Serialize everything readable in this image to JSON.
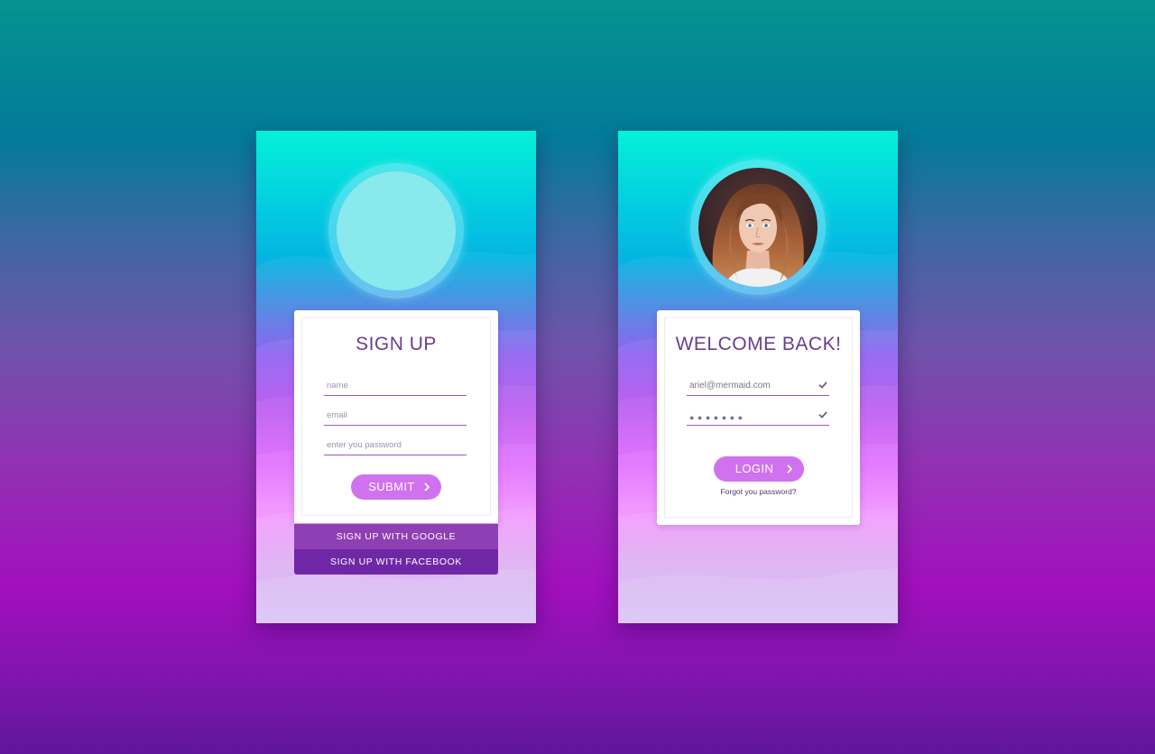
{
  "signup_card": {
    "title": "SIGN UP",
    "name_placeholder": "name",
    "email_placeholder": "email",
    "password_placeholder": "enter you password",
    "submit_label": "SUBMIT",
    "google_label": "SIGN UP WITH GOOGLE",
    "facebook_label": "SIGN UP WITH FACEBOOK"
  },
  "login_card": {
    "title": "WELCOME BACK!",
    "email_value": "ariel@mermaid.com",
    "password_value": "●●●●●●●",
    "login_label": "LOGIN",
    "forgot_label": "Forgot you password?"
  },
  "icons": {
    "chevron": "chevron-right-icon",
    "check": "check-icon"
  },
  "colors": {
    "accent_button": "#d071ef",
    "google_button": "#8e3fb4",
    "facebook_button": "#6f27a6",
    "title_text": "#6b3d8e",
    "field_underline": "#9a55c9"
  }
}
